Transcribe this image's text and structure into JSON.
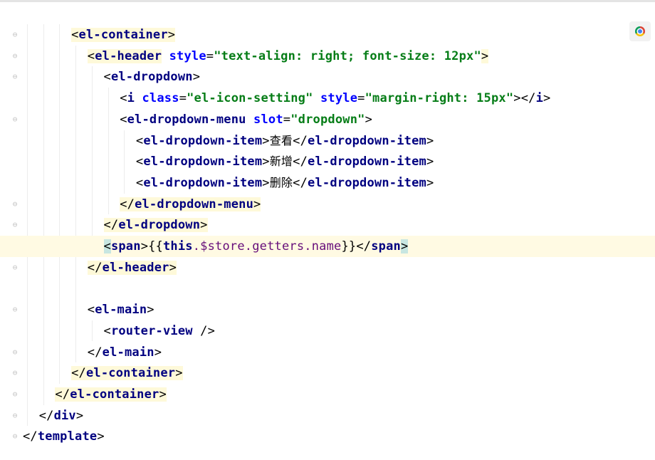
{
  "editor": {
    "lines": [
      {
        "indent": 4,
        "parts": [
          {
            "t": "<",
            "c": "b",
            "h": 1
          },
          {
            "t": "el-container",
            "c": "t",
            "h": 1
          },
          {
            "t": ">",
            "c": "b",
            "h": 1
          }
        ]
      },
      {
        "indent": 5,
        "parts": [
          {
            "t": "<",
            "c": "b",
            "h": 1
          },
          {
            "t": "el-header",
            "c": "t",
            "h": 1
          },
          {
            "t": " ",
            "c": "b"
          },
          {
            "t": "style",
            "c": "a"
          },
          {
            "t": "=",
            "c": "b"
          },
          {
            "t": "\"text-align: right; font-size: 12px\"",
            "c": "v"
          },
          {
            "t": ">",
            "c": "b",
            "h": 1
          }
        ]
      },
      {
        "indent": 6,
        "parts": [
          {
            "t": "<",
            "c": "b"
          },
          {
            "t": "el-dropdown",
            "c": "t"
          },
          {
            "t": ">",
            "c": "b"
          }
        ]
      },
      {
        "indent": 7,
        "parts": [
          {
            "t": "<",
            "c": "b"
          },
          {
            "t": "i",
            "c": "t"
          },
          {
            "t": " ",
            "c": "b"
          },
          {
            "t": "class",
            "c": "a"
          },
          {
            "t": "=",
            "c": "b"
          },
          {
            "t": "\"el-icon-setting\"",
            "c": "v"
          },
          {
            "t": " ",
            "c": "b"
          },
          {
            "t": "style",
            "c": "a"
          },
          {
            "t": "=",
            "c": "b"
          },
          {
            "t": "\"margin-right: 15px\"",
            "c": "v"
          },
          {
            "t": "></",
            "c": "b"
          },
          {
            "t": "i",
            "c": "t"
          },
          {
            "t": ">",
            "c": "b"
          }
        ]
      },
      {
        "indent": 7,
        "parts": [
          {
            "t": "<",
            "c": "b"
          },
          {
            "t": "el-dropdown-menu",
            "c": "t"
          },
          {
            "t": " ",
            "c": "b"
          },
          {
            "t": "slot",
            "c": "a"
          },
          {
            "t": "=",
            "c": "b"
          },
          {
            "t": "\"dropdown\"",
            "c": "v"
          },
          {
            "t": ">",
            "c": "b"
          }
        ]
      },
      {
        "indent": 8,
        "parts": [
          {
            "t": "<",
            "c": "b"
          },
          {
            "t": "el-dropdown-item",
            "c": "t"
          },
          {
            "t": ">",
            "c": "b"
          },
          {
            "t": "查看",
            "c": "x"
          },
          {
            "t": "</",
            "c": "b"
          },
          {
            "t": "el-dropdown-item",
            "c": "t"
          },
          {
            "t": ">",
            "c": "b"
          }
        ]
      },
      {
        "indent": 8,
        "parts": [
          {
            "t": "<",
            "c": "b"
          },
          {
            "t": "el-dropdown-item",
            "c": "t"
          },
          {
            "t": ">",
            "c": "b"
          },
          {
            "t": "新增",
            "c": "x"
          },
          {
            "t": "</",
            "c": "b"
          },
          {
            "t": "el-dropdown-item",
            "c": "t"
          },
          {
            "t": ">",
            "c": "b"
          }
        ]
      },
      {
        "indent": 8,
        "parts": [
          {
            "t": "<",
            "c": "b"
          },
          {
            "t": "el-dropdown-item",
            "c": "t"
          },
          {
            "t": ">",
            "c": "b"
          },
          {
            "t": "删除",
            "c": "x"
          },
          {
            "t": "</",
            "c": "b"
          },
          {
            "t": "el-dropdown-item",
            "c": "t"
          },
          {
            "t": ">",
            "c": "b"
          }
        ]
      },
      {
        "indent": 7,
        "parts": [
          {
            "t": "</",
            "c": "b",
            "h": 1
          },
          {
            "t": "el-dropdown-menu",
            "c": "t",
            "h": 1
          },
          {
            "t": ">",
            "c": "b",
            "h": 1
          }
        ]
      },
      {
        "indent": 6,
        "parts": [
          {
            "t": "</",
            "c": "b",
            "h": 1
          },
          {
            "t": "el-dropdown",
            "c": "t",
            "h": 1
          },
          {
            "t": ">",
            "c": "b",
            "h": 1
          }
        ]
      },
      {
        "indent": 6,
        "caret": true,
        "parts": [
          {
            "t": "<",
            "c": "b",
            "h": 2
          },
          {
            "t": "span",
            "c": "t"
          },
          {
            "t": ">",
            "c": "b"
          },
          {
            "t": "{{",
            "c": "b"
          },
          {
            "t": "this",
            "c": "t"
          },
          {
            "t": ".$store.getters.name",
            "c": "e"
          },
          {
            "t": "}}",
            "c": "b"
          },
          {
            "t": "</",
            "c": "b"
          },
          {
            "t": "span",
            "c": "t"
          },
          {
            "t": ">",
            "c": "b",
            "h": 2
          }
        ]
      },
      {
        "indent": 5,
        "parts": [
          {
            "t": "</",
            "c": "b",
            "h": 1
          },
          {
            "t": "el-header",
            "c": "t",
            "h": 1
          },
          {
            "t": ">",
            "c": "b",
            "h": 1
          }
        ]
      },
      {
        "indent": 5,
        "parts": []
      },
      {
        "indent": 5,
        "parts": [
          {
            "t": "<",
            "c": "b"
          },
          {
            "t": "el-main",
            "c": "t"
          },
          {
            "t": ">",
            "c": "b"
          }
        ]
      },
      {
        "indent": 6,
        "parts": [
          {
            "t": "<",
            "c": "b"
          },
          {
            "t": "router-view",
            "c": "t"
          },
          {
            "t": " />",
            "c": "b"
          }
        ]
      },
      {
        "indent": 5,
        "parts": [
          {
            "t": "</",
            "c": "b"
          },
          {
            "t": "el-main",
            "c": "t"
          },
          {
            "t": ">",
            "c": "b"
          }
        ]
      },
      {
        "indent": 4,
        "parts": [
          {
            "t": "</",
            "c": "b",
            "h": 1
          },
          {
            "t": "el-container",
            "c": "t",
            "h": 1
          },
          {
            "t": ">",
            "c": "b",
            "h": 1
          }
        ]
      },
      {
        "indent": 3,
        "parts": [
          {
            "t": "</",
            "c": "b",
            "h": 1
          },
          {
            "t": "el-container",
            "c": "t",
            "h": 1
          },
          {
            "t": ">",
            "c": "b",
            "h": 1
          }
        ]
      },
      {
        "indent": 2,
        "parts": [
          {
            "t": "</",
            "c": "b"
          },
          {
            "t": "div",
            "c": "t"
          },
          {
            "t": ">",
            "c": "b"
          }
        ]
      },
      {
        "indent": 1,
        "parts": [
          {
            "t": "</",
            "c": "b"
          },
          {
            "t": "template",
            "c": "t"
          },
          {
            "t": ">",
            "c": "b"
          }
        ]
      }
    ]
  },
  "icons": {
    "bulb": "lightbulb-icon",
    "browser": "chrome-icon",
    "fold": "fold-marker-icon"
  },
  "colors": {
    "tag": "#000080",
    "attribute": "#0000ff",
    "string": "#067d17",
    "caret_row": "#fffae3",
    "tag_highlight": "#fef9d9"
  }
}
